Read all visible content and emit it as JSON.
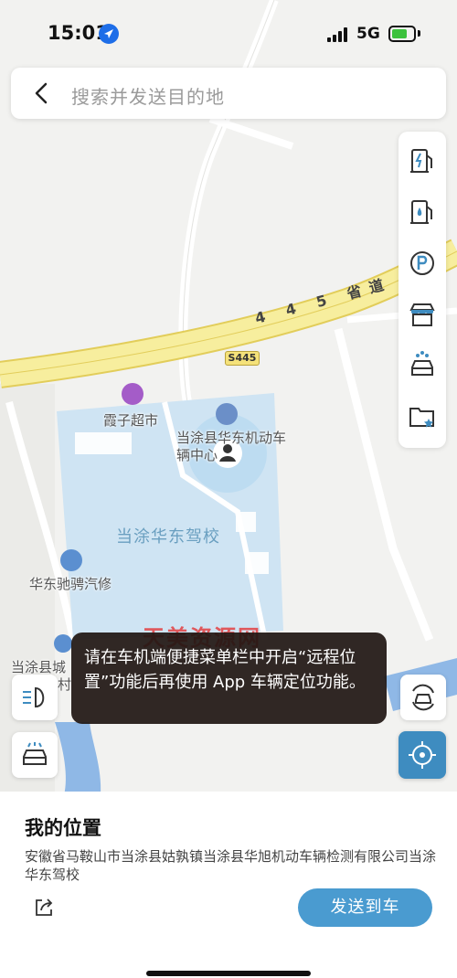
{
  "status": {
    "time": "15:01",
    "network": "5G",
    "icons": [
      "location-arrow-icon",
      "signal-icon",
      "battery-charging-icon"
    ]
  },
  "search": {
    "placeholder": "搜索并发送目的地",
    "back_icon": "chevron-left-icon"
  },
  "toolbar": {
    "items": [
      {
        "icon": "charging-station-icon"
      },
      {
        "icon": "gas-station-icon"
      },
      {
        "icon": "parking-icon"
      },
      {
        "icon": "store-icon"
      },
      {
        "icon": "car-wash-icon"
      },
      {
        "icon": "favorites-folder-icon"
      }
    ]
  },
  "map": {
    "road_name": "4 4 5 省道",
    "road_shield": "S445",
    "pois": {
      "supermarket": "霞子超市",
      "inspection_center": "当涂县华东机动车辆中心",
      "driving_school": "当涂华东驾校",
      "repair_shop": "华东驰骋汽修",
      "town_partial": "当涂县城",
      "town_partial_2": "穴村"
    },
    "colors": {
      "background": "#f2f2f0",
      "road_fill": "#f7ee9e",
      "road_border": "#e2cd5a",
      "school_area": "#cfe4f3",
      "water": "#8fb8e6",
      "accent": "#4a9bd0"
    }
  },
  "toast": {
    "message": "请在车机端便捷菜单栏中开启“远程位置”功能后再使用 App 车辆定位功能。",
    "watermark": "天美资源网"
  },
  "map_buttons": {
    "left": [
      "headlight-icon",
      "car-lights-icon"
    ],
    "right": [
      "car-refresh-icon",
      "locate-me-icon"
    ]
  },
  "sheet": {
    "title": "我的位置",
    "address": "安徽省马鞍山市当涂县姑孰镇当涂县华旭机动车辆检测有限公司当涂华东驾校",
    "send_button": "发送到车",
    "share_icon": "share-icon"
  }
}
